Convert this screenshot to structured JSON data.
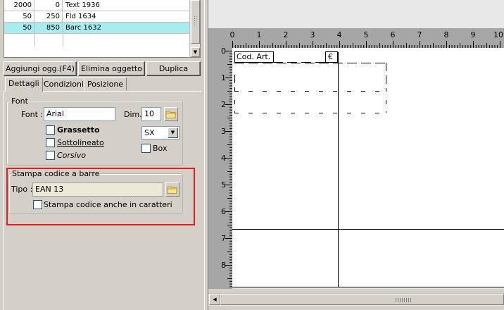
{
  "grid": {
    "rows": [
      {
        "col1": "2000",
        "col2": "0",
        "col3": "Text 1936",
        "selected": false
      },
      {
        "col1": "50",
        "col2": "250",
        "col3": "Fld 1634",
        "selected": false
      },
      {
        "col1": "50",
        "col2": "850",
        "col3": "Barc 1632",
        "selected": true
      }
    ]
  },
  "toolbar": {
    "add_label": "Aggiungi ogg.(F4)",
    "delete_label": "Elimina oggetto",
    "duplicate_label": "Duplica"
  },
  "tabs": [
    {
      "label": "Dettagli",
      "active": true
    },
    {
      "label": "Condizioni",
      "active": false
    },
    {
      "label": "Posizione",
      "active": false
    }
  ],
  "font_group": {
    "title": "Font",
    "font_label": "Font :",
    "font_value": "Arial",
    "dim_label": "Dim.",
    "dim_value": "10",
    "bold_label": "Grassetto",
    "underline_label": "Sottolineato",
    "italic_label": "Corsivo",
    "align_value": "SX",
    "box_label": "Box"
  },
  "barcode_group": {
    "title": "Stampa codice a barre",
    "type_label": "Tipo :",
    "type_value": "EAN 13",
    "print_chars_label": "Stampa codice anche in caratteri"
  },
  "ruler": {
    "h_labels": [
      "0",
      "1",
      "2",
      "3",
      "4",
      "5",
      "6",
      "7",
      "8",
      "9",
      "10"
    ],
    "v_labels": [
      "0",
      "1",
      "2",
      "3",
      "4",
      "5",
      "6",
      "7",
      "8"
    ]
  },
  "canvas": {
    "field_code_label": "Cod. Art.",
    "field_currency_label": "€"
  },
  "colors": {
    "selected_row": "#a8ecf0",
    "highlight_box": "#e02020"
  },
  "icons": {
    "folder": "folder-icon",
    "scroll_down": "arrow-down-icon",
    "scroll_left": "arrow-left-icon",
    "dropdown": "chevron-down-icon"
  }
}
